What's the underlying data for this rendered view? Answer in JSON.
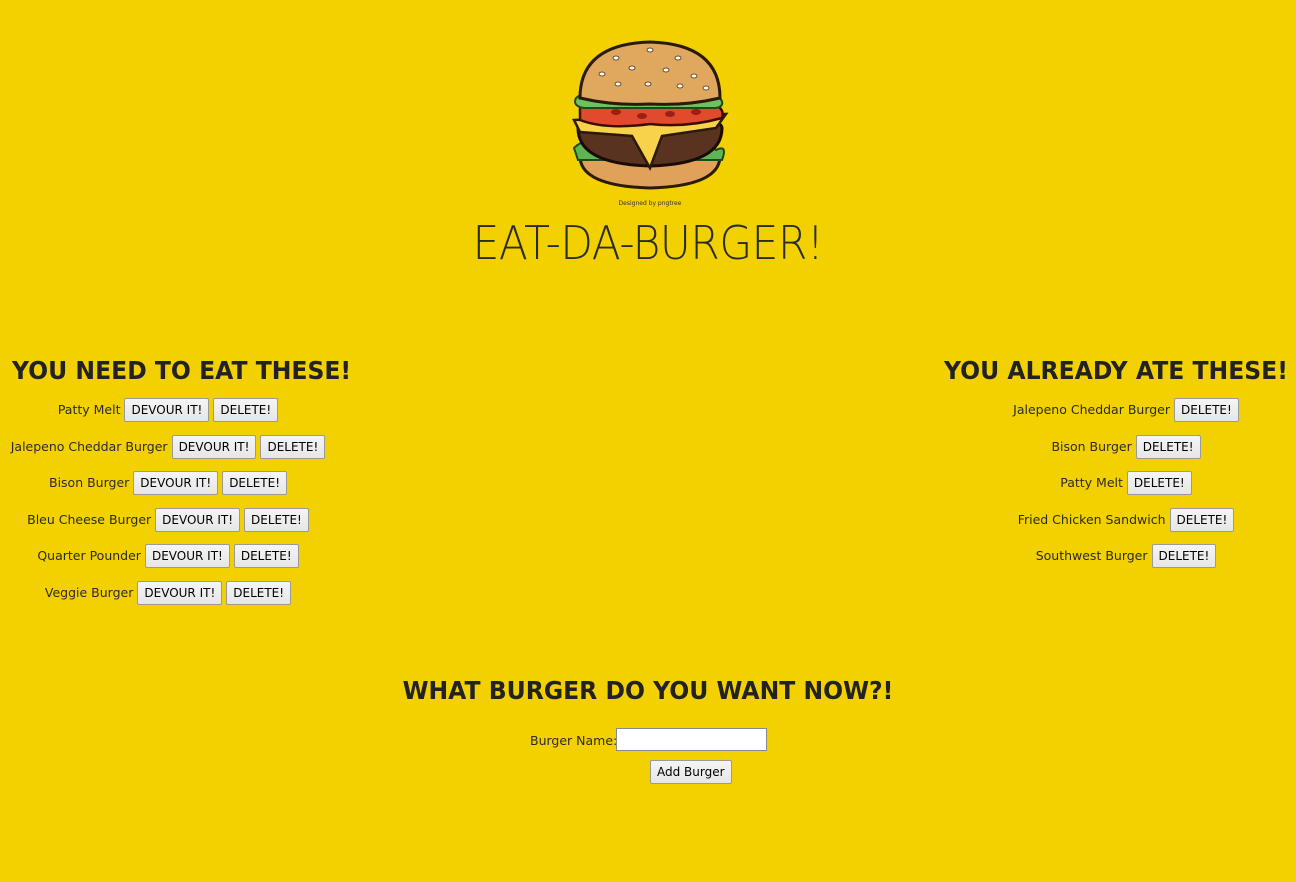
{
  "header": {
    "title": "EAT-DA-BURGER!",
    "logo_icon": "burger-icon",
    "logo_credit": "Designed by pngtree"
  },
  "to_eat": {
    "heading": "YOU NEED TO EAT THESE!",
    "devour_label": "DEVOUR IT!",
    "delete_label": "DELETE!",
    "items": [
      {
        "name": "Patty Melt"
      },
      {
        "name": "Jalepeno Cheddar Burger"
      },
      {
        "name": "Bison Burger"
      },
      {
        "name": "Bleu Cheese Burger"
      },
      {
        "name": "Quarter Pounder"
      },
      {
        "name": "Veggie Burger"
      }
    ]
  },
  "eaten": {
    "heading": "YOU ALREADY ATE THESE!",
    "delete_label": "DELETE!",
    "items": [
      {
        "name": "Jalepeno Cheddar Burger"
      },
      {
        "name": "Bison Burger"
      },
      {
        "name": "Patty Melt"
      },
      {
        "name": "Fried Chicken Sandwich"
      },
      {
        "name": "Southwest Burger"
      }
    ]
  },
  "form": {
    "heading": "WHAT BURGER DO YOU WANT NOW?!",
    "label": "Burger Name:",
    "input_value": "",
    "submit_label": "Add Burger"
  },
  "colors": {
    "background": "#f3d000",
    "text": "#2b2b2b"
  }
}
